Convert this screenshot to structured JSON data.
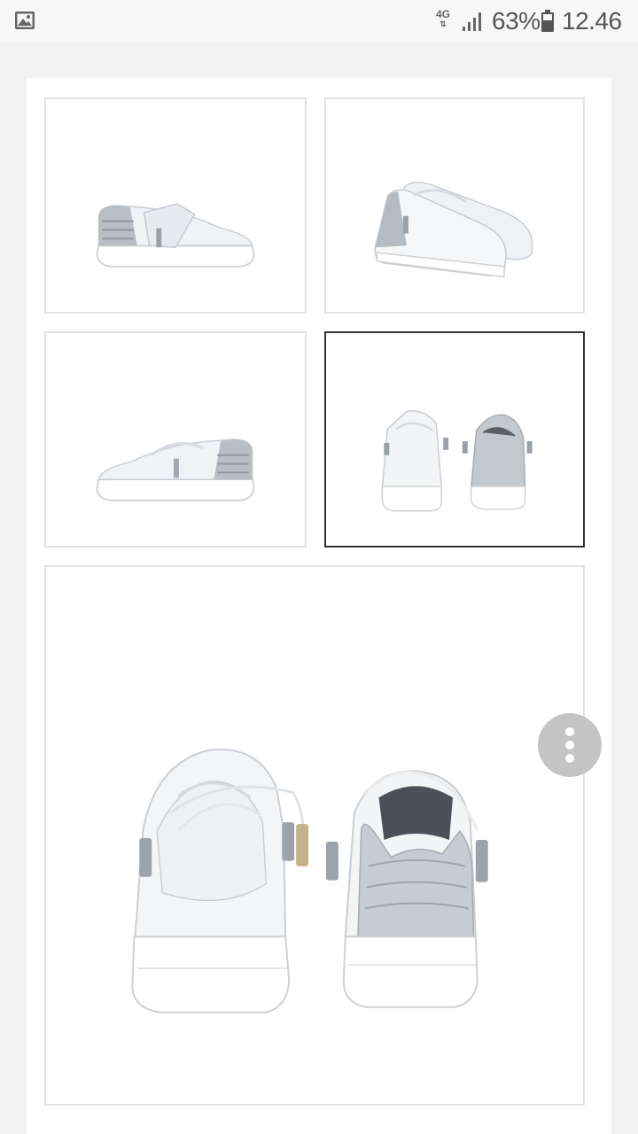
{
  "status_bar": {
    "network": "4G",
    "battery_percent": "63%",
    "time": "12.46",
    "icons": [
      "gallery-icon",
      "network-4g-icon",
      "signal-icon",
      "battery-icon"
    ]
  },
  "gallery": {
    "thumbnails": [
      {
        "view": "side-left",
        "selected": false
      },
      {
        "view": "angled-pair",
        "selected": false
      },
      {
        "view": "side-right",
        "selected": false
      },
      {
        "view": "front-back",
        "selected": true
      }
    ],
    "main_image": {
      "view": "front-back"
    }
  },
  "menu_button": {
    "icon": "more-vertical-icon"
  }
}
